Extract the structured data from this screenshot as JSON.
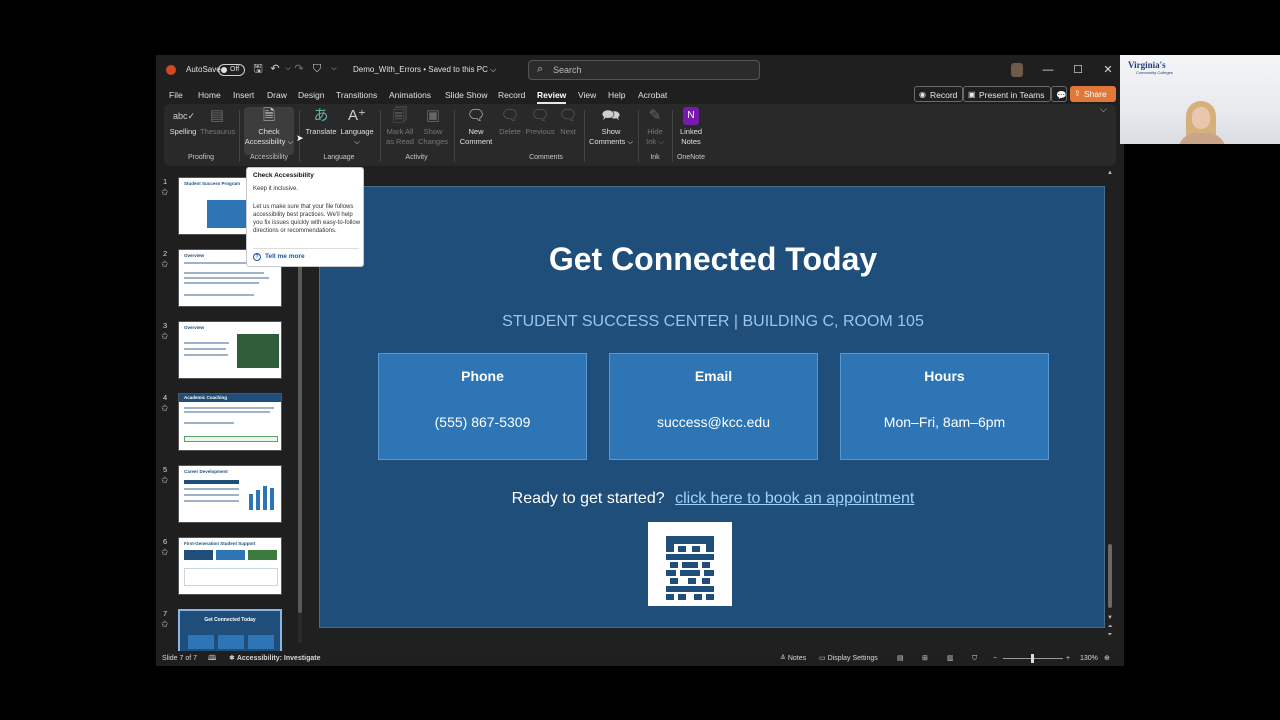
{
  "titlebar": {
    "autosave_label": "AutoSave",
    "autosave_state": "Off",
    "doc_title": "Demo_With_Errors • Saved to this PC ⌵",
    "search_placeholder": "Search"
  },
  "tabs": [
    "File",
    "Home",
    "Insert",
    "Draw",
    "Design",
    "Transitions",
    "Animations",
    "Slide Show",
    "Record",
    "Review",
    "View",
    "Help",
    "Acrobat"
  ],
  "active_tab": "Review",
  "top_buttons": {
    "record": "Record",
    "present_teams": "Present in Teams",
    "share": "Share"
  },
  "ribbon": {
    "spelling": "Spelling",
    "thesaurus": "Thesaurus",
    "check_accessibility_1": "Check",
    "check_accessibility_2": "Accessibility ⌵",
    "translate": "Translate",
    "language": "Language",
    "mark_all_read_1": "Mark All",
    "mark_all_read_2": "as Read",
    "show_changes_1": "Show",
    "show_changes_2": "Changes",
    "new_comment_1": "New",
    "new_comment_2": "Comment",
    "delete": "Delete",
    "previous": "Previous",
    "next": "Next",
    "show_comments_1": "Show",
    "show_comments_2": "Comments ⌵",
    "hide_ink_1": "Hide",
    "hide_ink_2": "Ink ⌵",
    "linked_notes_1": "Linked",
    "linked_notes_2": "Notes",
    "groups": {
      "proofing": "Proofing",
      "accessibility": "Accessibility",
      "language": "Language",
      "activity": "Activity",
      "comments": "Comments",
      "ink": "Ink",
      "onenote": "OneNote"
    }
  },
  "tooltip": {
    "title": "Check Accessibility",
    "subtitle": "Keep it inclusive.",
    "body": "Let us make sure that your file follows accessibility best practices. We'll help you fix issues quickly with easy-to-follow directions or recommendations.",
    "link": "Tell me more"
  },
  "thumbnails": [
    {
      "num": "1",
      "title": "Student Success Program"
    },
    {
      "num": "2",
      "title": "Overview"
    },
    {
      "num": "3",
      "title": "Overview"
    },
    {
      "num": "4",
      "title": "Academic Coaching"
    },
    {
      "num": "5",
      "title": "Career Development"
    },
    {
      "num": "6",
      "title": "First-Generation Student Support"
    },
    {
      "num": "7",
      "title": "Get Connected Today"
    }
  ],
  "slide": {
    "title": "Get Connected Today",
    "subtitle": "STUDENT SUCCESS CENTER  |  BUILDING C, ROOM 105",
    "cards": [
      {
        "heading": "Phone",
        "value": "(555) 867-5309"
      },
      {
        "heading": "Email",
        "value": "success@kcc.edu"
      },
      {
        "heading": "Hours",
        "value": "Mon–Fri, 8am–6pm"
      }
    ],
    "cta_text": "Ready to get started?",
    "cta_link": "click here to book an appointment"
  },
  "statusbar": {
    "slide_counter": "Slide 7 of 7",
    "accessibility": "Accessibility: Investigate",
    "notes": "Notes",
    "display_settings": "Display Settings",
    "zoom": "130%"
  },
  "webcam": {
    "logo_text": "Virginia's",
    "logo_subtext": "Community Colleges"
  },
  "colors": {
    "slide_bg": "#1e4e79",
    "card_bg": "#2e75b6",
    "share_btn": "#e0783a"
  }
}
